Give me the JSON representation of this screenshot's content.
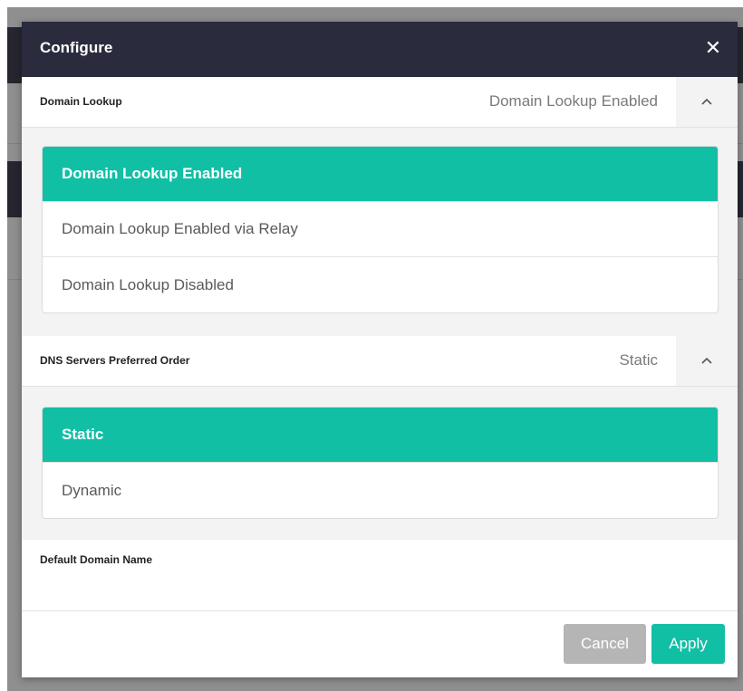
{
  "dialog": {
    "title": "Configure",
    "close_icon": "close-icon"
  },
  "domain_lookup": {
    "label": "Domain Lookup",
    "value": "Domain Lookup Enabled",
    "options": [
      {
        "label": "Domain Lookup Enabled",
        "selected": true
      },
      {
        "label": "Domain Lookup Enabled via Relay",
        "selected": false
      },
      {
        "label": "Domain Lookup Disabled",
        "selected": false
      }
    ]
  },
  "dns_servers": {
    "label": "DNS Servers Preferred Order",
    "value": "Static",
    "options": [
      {
        "label": "Static",
        "selected": true
      },
      {
        "label": "Dynamic",
        "selected": false
      }
    ]
  },
  "default_domain": {
    "label": "Default Domain Name",
    "value": ""
  },
  "footer": {
    "cancel_label": "Cancel",
    "apply_label": "Apply"
  },
  "colors": {
    "accent": "#11bfa5",
    "header": "#2a2b3d",
    "cancel": "#b5b5b5"
  }
}
